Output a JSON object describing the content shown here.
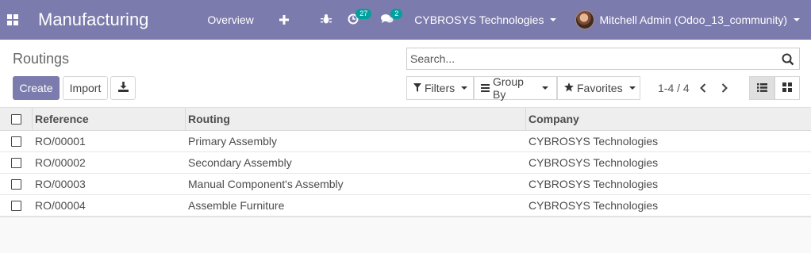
{
  "navbar": {
    "app_name": "Manufacturing",
    "menu": [
      {
        "label": "Overview"
      }
    ],
    "activity_count": "27",
    "message_count": "2",
    "company": "CYBROSYS Technologies",
    "user": "Mitchell Admin (Odoo_13_community)",
    "bg_color": "#7c7bad"
  },
  "control_panel": {
    "breadcrumb": "Routings",
    "create_label": "Create",
    "import_label": "Import",
    "search_placeholder": "Search...",
    "filters_label": "Filters",
    "group_by_label": "Group By",
    "favorites_label": "Favorites",
    "pager": "1-4 / 4"
  },
  "table": {
    "columns": {
      "reference": "Reference",
      "routing": "Routing",
      "company": "Company"
    },
    "rows": [
      {
        "reference": "RO/00001",
        "routing": "Primary Assembly",
        "company": "CYBROSYS Technologies"
      },
      {
        "reference": "RO/00002",
        "routing": "Secondary Assembly",
        "company": "CYBROSYS Technologies"
      },
      {
        "reference": "RO/00003",
        "routing": "Manual Component's Assembly",
        "company": "CYBROSYS Technologies"
      },
      {
        "reference": "RO/00004",
        "routing": "Assemble Furniture",
        "company": "CYBROSYS Technologies"
      }
    ]
  },
  "icons": [
    "apps-icon",
    "plus-icon",
    "bug-icon",
    "activity-icon",
    "chat-icon",
    "download-icon",
    "search-icon",
    "filter-icon",
    "group-by-icon",
    "star-icon",
    "chevron-left-icon",
    "chevron-right-icon",
    "list-view-icon",
    "kanban-view-icon"
  ]
}
